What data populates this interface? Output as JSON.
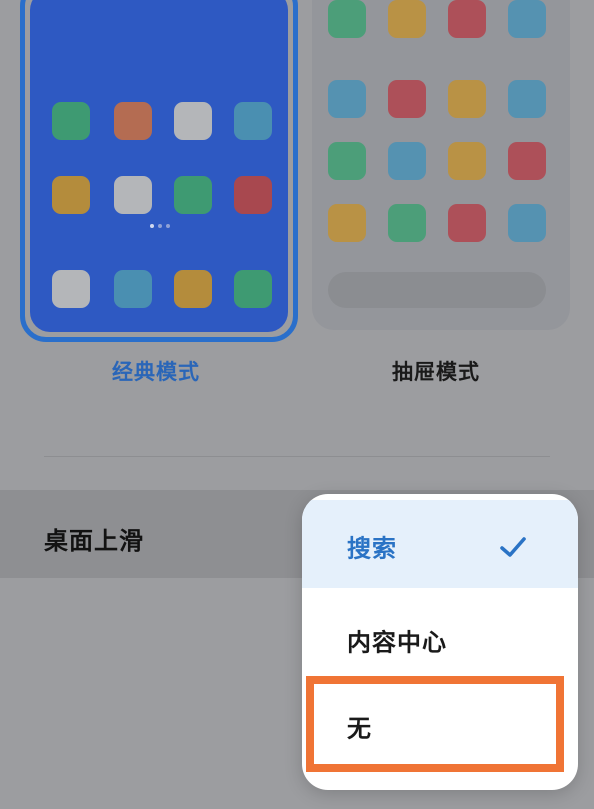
{
  "modes": {
    "classic_label": "经典模式",
    "drawer_label": "抽屉模式",
    "selected": "classic"
  },
  "settings_row": {
    "title": "桌面上滑"
  },
  "dropdown": {
    "options": [
      {
        "label": "搜索",
        "selected": true
      },
      {
        "label": "内容中心",
        "selected": false
      },
      {
        "label": "无",
        "selected": false
      }
    ],
    "highlighted_option": "无"
  },
  "icons": {
    "check": "check-icon"
  },
  "colors": {
    "accent_blue": "#2a73c5",
    "highlight_orange": "#f07435",
    "classic_screen": "#2e59c2"
  }
}
